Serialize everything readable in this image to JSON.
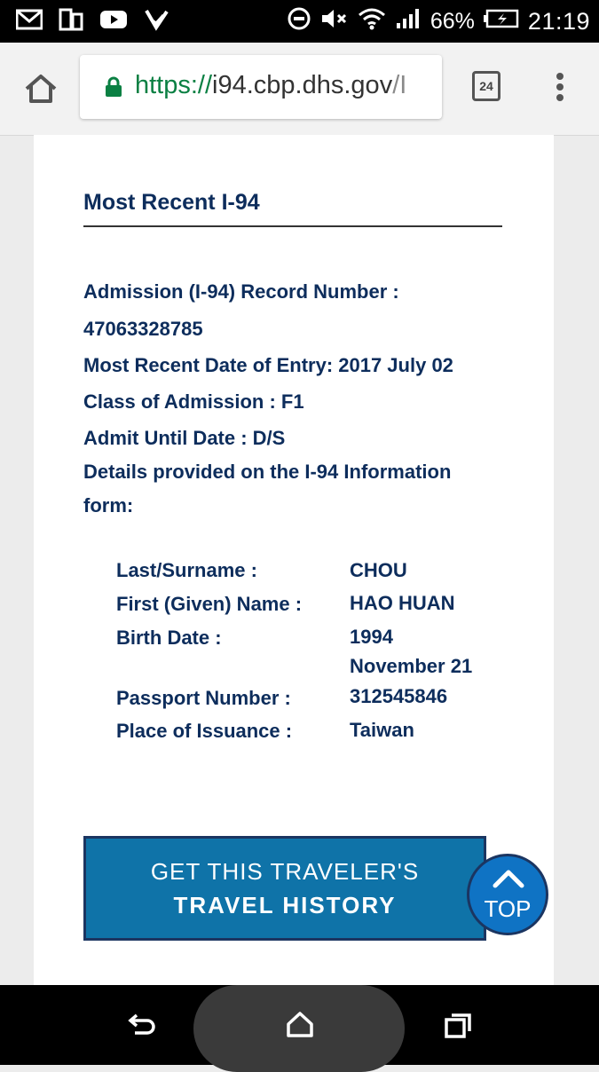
{
  "status_bar": {
    "battery": "66%",
    "time": "21:19",
    "icons": [
      "gmail-icon",
      "device-icon",
      "youtube-icon",
      "check-icon",
      "dnd-icon",
      "mute-icon",
      "wifi-icon",
      "signal-icon",
      "battery-icon"
    ]
  },
  "browser": {
    "url_scheme": "https://",
    "url_domain": "i94.cbp.dhs.gov",
    "url_rest": "/I",
    "tab_count": "24"
  },
  "record": {
    "heading": "Most Recent I-94",
    "record_number_label": "Admission (I-94) Record Number :",
    "record_number": "47063328785",
    "entry_date": "Most Recent Date of Entry: 2017 July 02",
    "class_of_admission": "Class of Admission : F1",
    "admit_until": "Admit Until Date : D/S",
    "details_intro_1": "Details provided on the I-94 Information",
    "details_intro_2": "form:"
  },
  "details": {
    "surname_label": "Last/Surname :",
    "surname": "CHOU",
    "first_name_label": "First (Given) Name :",
    "first_name": "HAO HUAN",
    "birth_date_label": "Birth Date :",
    "birth_date_line1": "1994",
    "birth_date_line2": "November 21",
    "passport_label": "Passport Number :",
    "passport": "312545846",
    "issuance_label": "Place of Issuance :",
    "issuance": "Taiwan"
  },
  "actions": {
    "cta_line1": "GET THIS TRAVELER'S",
    "cta_line2": "TRAVEL HISTORY",
    "top_label": "TOP"
  },
  "colors": {
    "text_navy": "#0d2d5c",
    "cta_blue": "#0f73a8",
    "top_blue": "#0f73c4",
    "secure_green": "#0b8043"
  }
}
